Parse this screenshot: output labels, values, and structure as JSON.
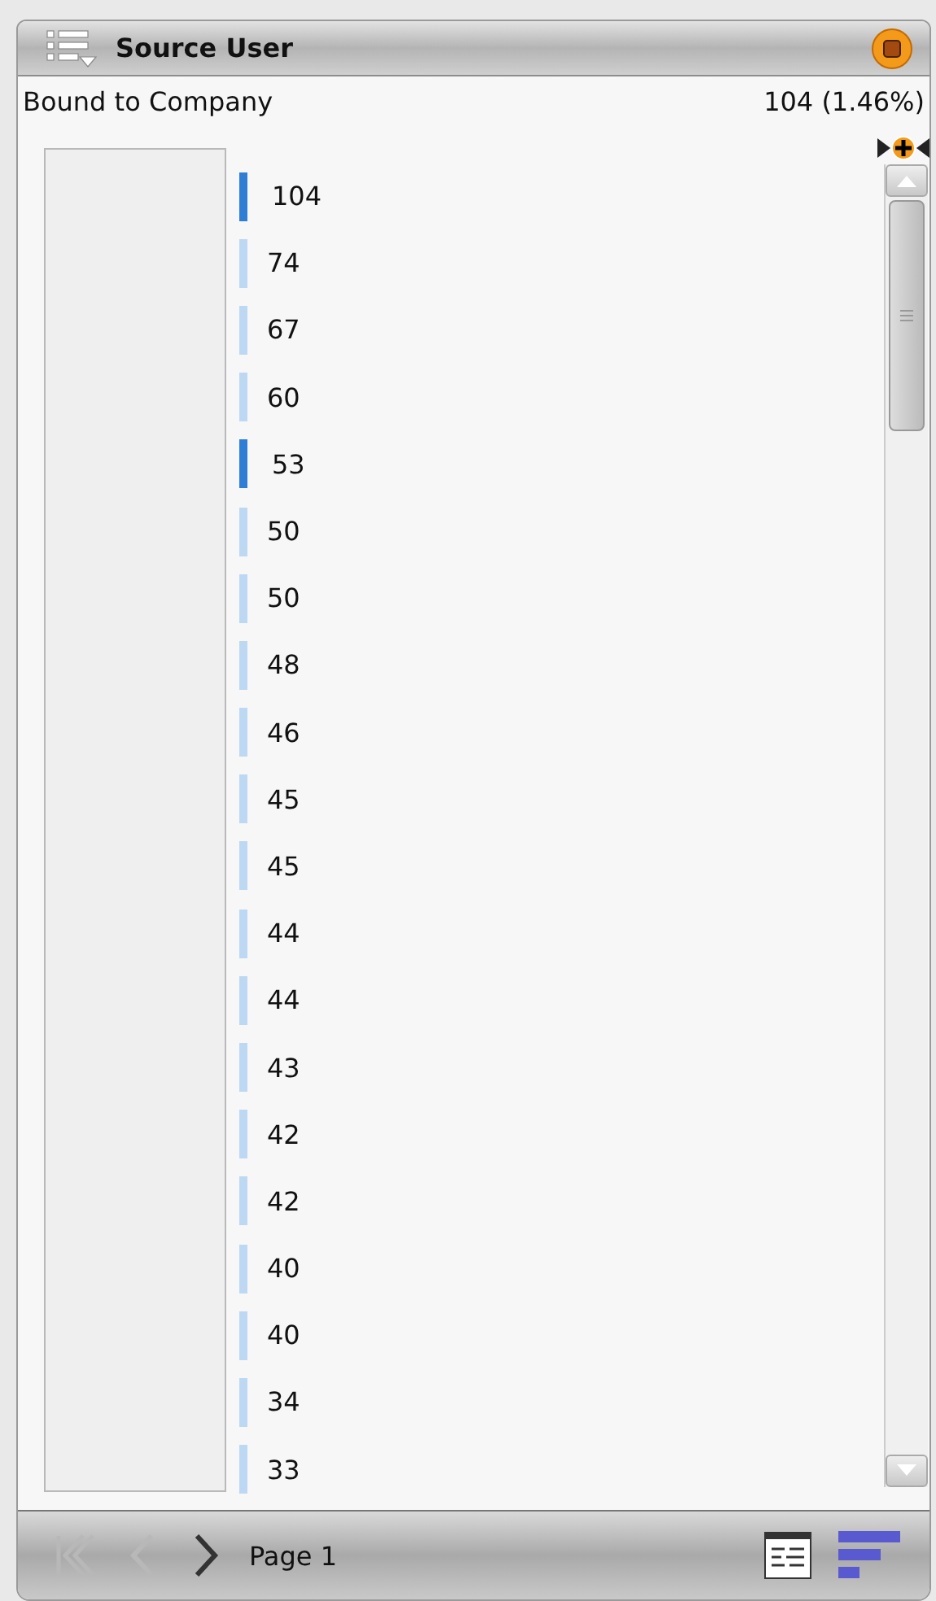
{
  "header": {
    "title": "Source User"
  },
  "summary": {
    "label": "Bound to Company",
    "value": "104 (1.46%)"
  },
  "rows": [
    {
      "value": "104",
      "selected": true
    },
    {
      "value": "74",
      "selected": false
    },
    {
      "value": "67",
      "selected": false
    },
    {
      "value": "60",
      "selected": false
    },
    {
      "value": "53",
      "selected": true
    },
    {
      "value": "50",
      "selected": false
    },
    {
      "value": "50",
      "selected": false
    },
    {
      "value": "48",
      "selected": false
    },
    {
      "value": "46",
      "selected": false
    },
    {
      "value": "45",
      "selected": false
    },
    {
      "value": "45",
      "selected": false
    },
    {
      "value": "44",
      "selected": false
    },
    {
      "value": "44",
      "selected": false
    },
    {
      "value": "43",
      "selected": false
    },
    {
      "value": "42",
      "selected": false
    },
    {
      "value": "42",
      "selected": false
    },
    {
      "value": "40",
      "selected": false
    },
    {
      "value": "40",
      "selected": false
    },
    {
      "value": "34",
      "selected": false
    },
    {
      "value": "33",
      "selected": false
    }
  ],
  "pager": {
    "first_disabled": true,
    "prev_disabled": true,
    "next_disabled": false,
    "page": "Page 1"
  }
}
